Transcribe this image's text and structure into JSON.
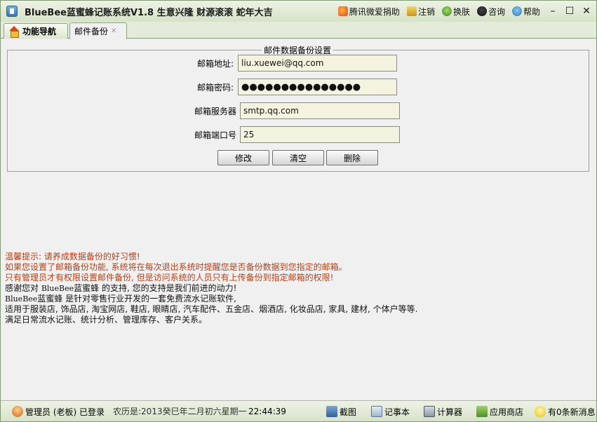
{
  "window": {
    "title": "BlueBee蓝蜜蜂记账系统V1.8 生意兴隆  财源滚滚  蛇年大吉",
    "links": [
      {
        "label": "腾讯微爱捐助",
        "icon": "heart-icon"
      },
      {
        "label": "注销",
        "icon": "lock-icon"
      },
      {
        "label": "换肤",
        "icon": "skin-icon"
      },
      {
        "label": "咨询",
        "icon": "qq-icon"
      },
      {
        "label": "帮助",
        "icon": "help-icon"
      }
    ],
    "controls": {
      "minimize": "–",
      "maximize": "☐",
      "close": "✕"
    }
  },
  "tabs": [
    {
      "label": "功能导航",
      "icon": "home-icon"
    },
    {
      "label": "邮件备份",
      "close": "✕"
    }
  ],
  "form": {
    "legend": "邮件数据备份设置",
    "fields": {
      "email_label": "邮箱地址:",
      "email_value": "liu.xuewei@qq.com",
      "password_label": "邮箱密码:",
      "password_value": "●●●●●●●●●●●●●●●",
      "server_label": "邮箱服务器",
      "server_value": "smtp.qq.com",
      "port_label": "邮箱端口号",
      "port_value": "25"
    },
    "buttons": {
      "modify": "修改",
      "clear": "清空",
      "delete": "删除"
    }
  },
  "notes": {
    "line1": "温馨提示: 请养成数据备份的好习惯!",
    "line2": "如果您设置了邮箱备份功能, 系统将在每次退出系统时提醒您是否备份数据到您指定的邮箱。",
    "line3": "只有管理员才有权限设置邮件备份, 但是访问系统的人员只有上传备份到指定邮箱的权限!",
    "line4_a": "感谢您对 ",
    "line4_b": "BlueBee",
    "line4_c": "蓝蜜蜂 的支持, 您的支持是我们前进的动力!",
    "line5_a": "BlueBee",
    "line5_b": "蓝蜜蜂 是针对零售行业开发的一套免费流水记账软件,",
    "line6": "适用于服装店, 饰品店, 淘宝网店, 鞋店, 眼睛店, 汽车配件、五金店、烟酒店, 化妆品店, 家具, 建材, 个体户等等.",
    "line7": "满足日常流水记账、统计分析、管理库存、客户关系。"
  },
  "status": {
    "user": "管理员 (老板) 已登录",
    "scroll_text": "农历是:2013癸巳年二月初六星期一",
    "time": "22:44:39",
    "tools": [
      "截图",
      "记事本",
      "计算器",
      "应用商店"
    ],
    "messages": "有0条新消息"
  }
}
